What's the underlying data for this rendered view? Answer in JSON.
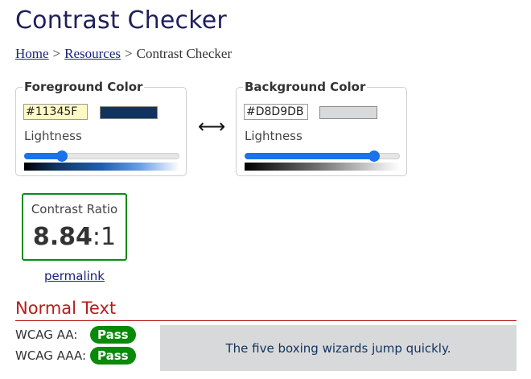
{
  "page": {
    "title": "Contrast Checker"
  },
  "breadcrumb": {
    "home": "Home",
    "resources": "Resources",
    "current": "Contrast Checker",
    "separator": ">"
  },
  "foreground": {
    "legend": "Foreground Color",
    "hex": "#11345F",
    "swatch_color": "#11345F",
    "lightness_label": "Lightness",
    "lightness": 0.24
  },
  "background": {
    "legend": "Background Color",
    "hex": "#D8D9DB",
    "swatch_color": "#D8D9DB",
    "lightness_label": "Lightness",
    "lightness": 0.84
  },
  "swap": {
    "glyph": "⟷"
  },
  "ratio": {
    "label": "Contrast Ratio",
    "value": "8.84",
    "suffix": ":1"
  },
  "permalink": {
    "label": "permalink"
  },
  "normal_text": {
    "title": "Normal Text",
    "aa_label": "WCAG AA:",
    "aa_result": "Pass",
    "aaa_label": "WCAG AAA:",
    "aaa_result": "Pass",
    "preview": "The five boxing wizards jump quickly."
  },
  "colors": {
    "pass": "#0a8a0a",
    "section_heading": "#b71c1c",
    "slider": "#1a73e8",
    "ratio_border": "#0a8a1a"
  }
}
